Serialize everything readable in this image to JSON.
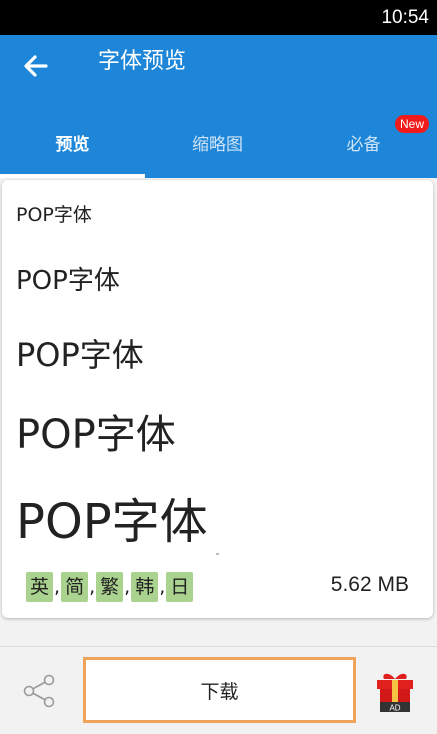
{
  "status_bar": {
    "time": "10:54"
  },
  "app_bar": {
    "title": "字体预览",
    "tabs": [
      {
        "label": "预览",
        "active": true
      },
      {
        "label": "缩略图",
        "active": false
      },
      {
        "label": "必备",
        "active": false,
        "badge": "New"
      }
    ]
  },
  "preview": {
    "samples": [
      "POP字体",
      "POP字体",
      "POP字体",
      "POP字体",
      "POP字体"
    ],
    "languages": [
      "英",
      "简",
      "繁",
      "韩",
      "日"
    ],
    "separator": ",",
    "file_size": "5.62 MB"
  },
  "bottom_bar": {
    "download_label": "下载",
    "gift_label": "AD"
  },
  "colors": {
    "primary": "#1d86d8",
    "badge": "#f21b1b",
    "lang_chip": "#a9d38e",
    "download_border": "#f0a35a",
    "gift": "#e0201c"
  }
}
